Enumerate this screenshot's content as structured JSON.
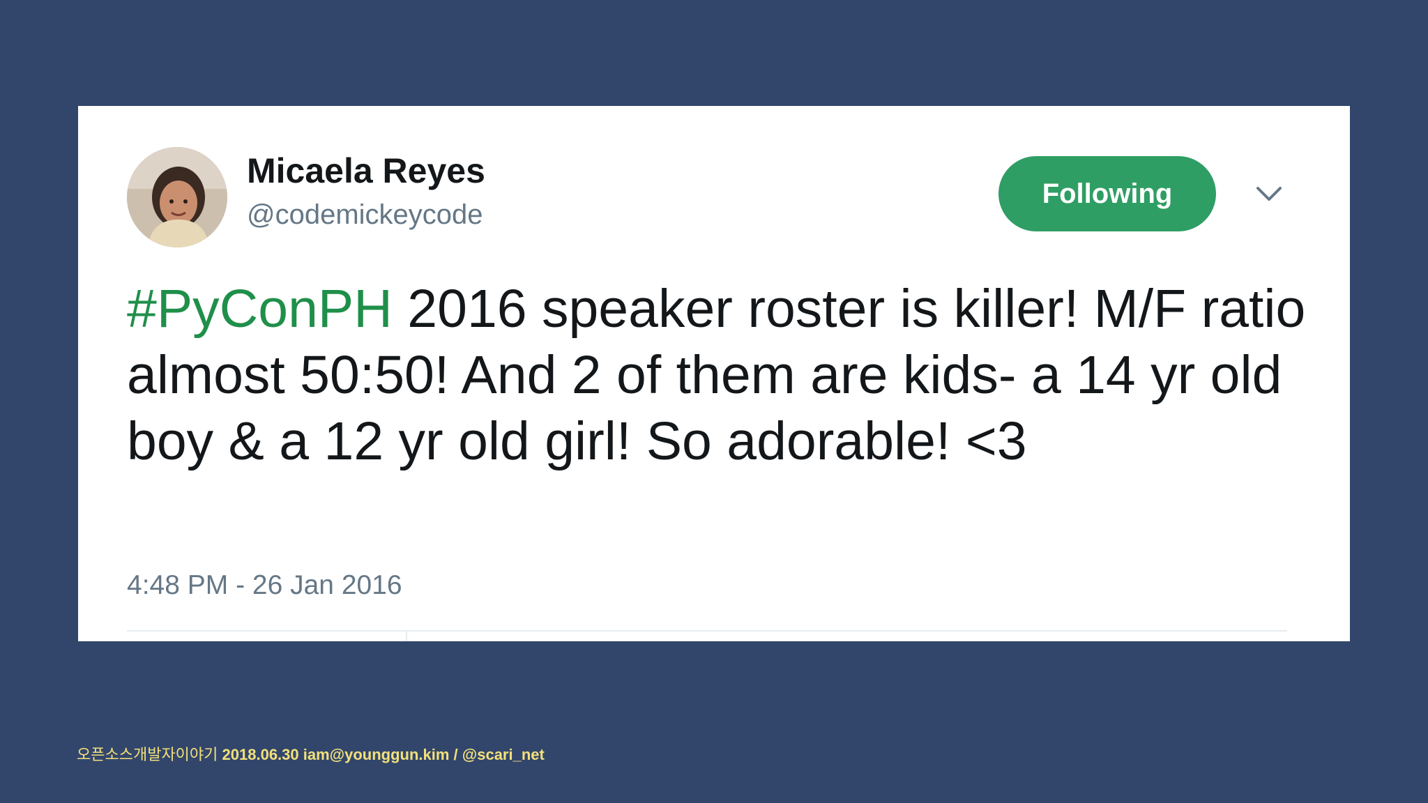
{
  "tweet": {
    "user_name": "Micaela Reyes",
    "user_handle": "@codemickeycode",
    "follow_label": "Following",
    "hashtag": "#PyConPH",
    "text": " 2016 speaker roster is killer! M/F ratio almost 50:50! And 2 of them are kids- a 14 yr old boy & a 12 yr old girl! So adorable! <3",
    "timestamp": "4:48 PM - 26 Jan 2016"
  },
  "footer": {
    "title": "오픈소스개발자이야기",
    "meta": "2018.06.30 iam@younggun.kim / @scari_net"
  },
  "colors": {
    "background": "#32466c",
    "card": "#ffffff",
    "follow_button": "#2f9e64",
    "hashtag": "#1f8f4a",
    "footer_text": "#f3e07a"
  },
  "icons": {
    "avatar": "profile-photo",
    "menu": "chevron-down-icon"
  }
}
